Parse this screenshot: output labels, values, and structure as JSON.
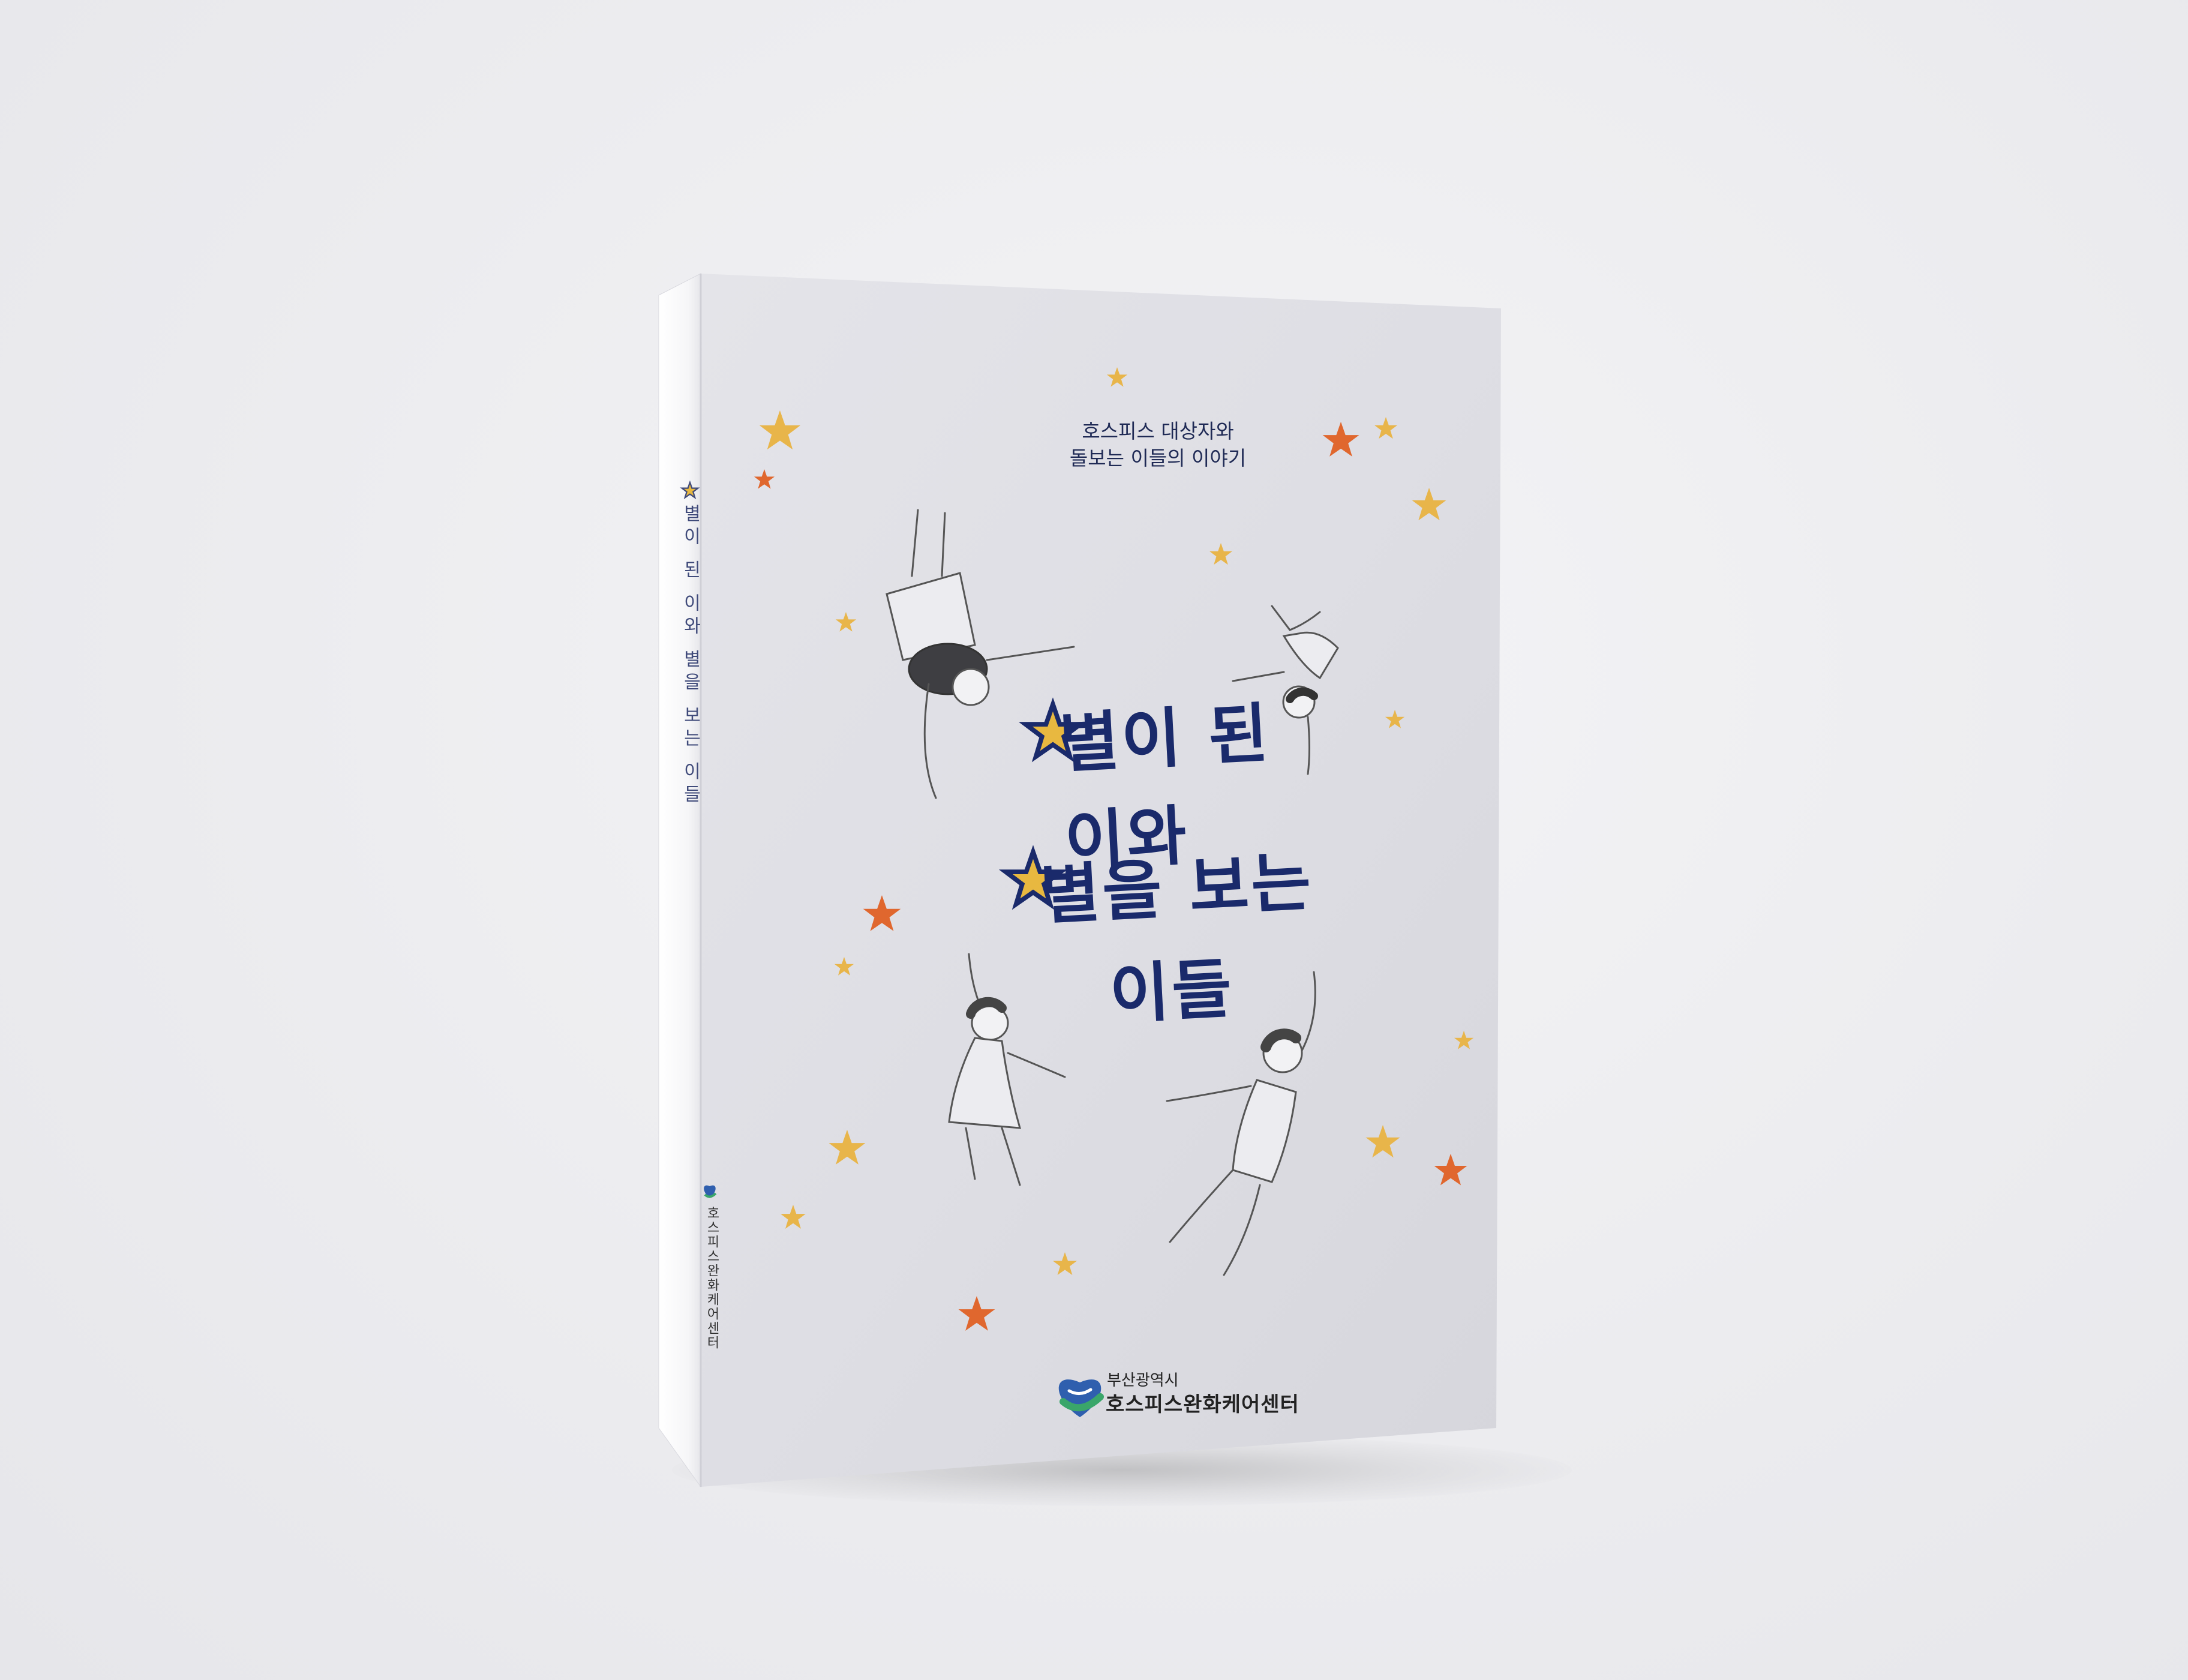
{
  "cover": {
    "subtitle_line1": "호스피스 대상자와",
    "subtitle_line2": "돌보는 이들의 이야기",
    "title_lines": [
      {
        "star": true,
        "text": "별이 된"
      },
      {
        "star": false,
        "text": "이와"
      },
      {
        "star": true,
        "text": "별을 보는"
      },
      {
        "star": false,
        "text": "이들"
      }
    ],
    "publisher_city": "부산광역시",
    "publisher_name": "호스피스완화케어센터"
  },
  "spine": {
    "title": "별이 된 이와 별을 보는 이들",
    "publisher": "호스피스완화케어센터"
  },
  "colors": {
    "background": "#ececef",
    "cover": "#e0e0e5",
    "spine": "#f6f6f8",
    "title_navy": "#1a2a6b",
    "star_gold": "#e8b54a",
    "star_orange": "#e0672e",
    "logo_blue": "#2f5fae",
    "logo_green": "#3aa66a"
  },
  "icons": {
    "stars": "star-icon",
    "figures": "figure-illustration",
    "logo": "hospice-heart-logo-icon"
  }
}
